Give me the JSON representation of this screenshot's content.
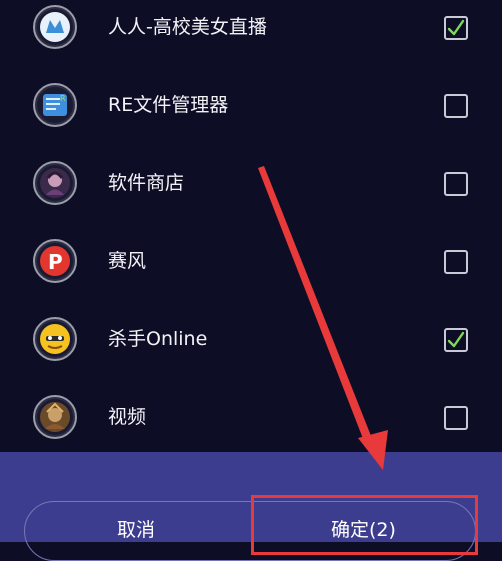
{
  "apps": [
    {
      "name": "人人-高校美女直播",
      "icon": "renren-app-icon",
      "checked": true
    },
    {
      "name": "RE文件管理器",
      "icon": "re-file-manager-icon",
      "checked": false
    },
    {
      "name": "软件商店",
      "icon": "app-store-icon",
      "checked": false
    },
    {
      "name": "赛风",
      "icon": "psiphon-icon",
      "checked": false
    },
    {
      "name": "杀手Online",
      "icon": "killer-online-icon",
      "checked": true
    },
    {
      "name": "视频",
      "icon": "video-app-icon",
      "checked": false
    }
  ],
  "footer": {
    "cancel_label": "取消",
    "confirm_label": "确定(2)"
  },
  "colors": {
    "background": "#0d0e26",
    "footer": "#3d3d8f",
    "check": "#7ed957",
    "annotation": "#e83a3a"
  }
}
